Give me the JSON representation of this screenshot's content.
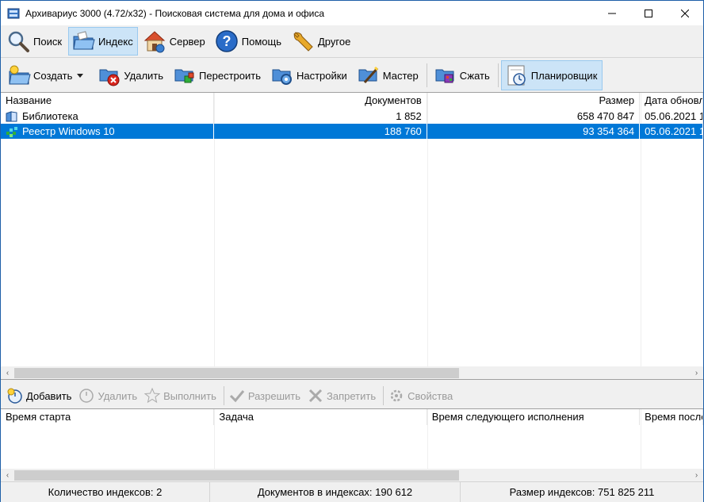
{
  "window": {
    "title": "Архивариус 3000 (4.72/x32) - Поисковая система для дома и офиса",
    "controls": {
      "minimize": "—",
      "maximize": "☐",
      "close": "✕"
    }
  },
  "modebar": {
    "items": [
      {
        "label": "Поиск",
        "icon": "search-icon",
        "active": false
      },
      {
        "label": "Индекс",
        "icon": "index-folder-icon",
        "active": true
      },
      {
        "label": "Сервер",
        "icon": "server-house-icon",
        "active": false
      },
      {
        "label": "Помощь",
        "icon": "help-icon",
        "active": false
      },
      {
        "label": "Другое",
        "icon": "wrench-icon",
        "active": false
      }
    ]
  },
  "actionbar": {
    "create": "Создать",
    "delete": "Удалить",
    "rebuild": "Перестроить",
    "settings": "Настройки",
    "wizard": "Мастер",
    "compress": "Сжать",
    "scheduler": "Планировщик"
  },
  "index_table": {
    "columns": [
      "Название",
      "Документов",
      "Размер",
      "Дата обновл"
    ],
    "rows": [
      {
        "name": "Библиотека",
        "documents": "1 852",
        "size": "658 470 847",
        "date": "05.06.2021 1",
        "selected": false,
        "icon": "book-icon"
      },
      {
        "name": "Реестр Windows 10",
        "documents": "188 760",
        "size": "93 354 364",
        "date": "05.06.2021 1",
        "selected": true,
        "icon": "registry-icon"
      }
    ],
    "scroll_left": "‹",
    "scroll_right": "›"
  },
  "scheduler_bar": {
    "add": "Добавить",
    "delete": "Удалить",
    "run": "Выполнить",
    "allow": "Разрешить",
    "deny": "Запретить",
    "properties": "Свойства"
  },
  "scheduler_table": {
    "columns": [
      "Время старта",
      "Задача",
      "Время следующего исполнения",
      "Время после"
    ]
  },
  "statusbar": {
    "index_count": "Количество индексов: 2",
    "documents_in_indexes": "Документов в индексах: 190 612",
    "indexes_size": "Размер индексов: 751 825 211"
  },
  "colors": {
    "selection": "#0078d7",
    "active_button": "#cce4f7",
    "active_border": "#99c9ef"
  }
}
